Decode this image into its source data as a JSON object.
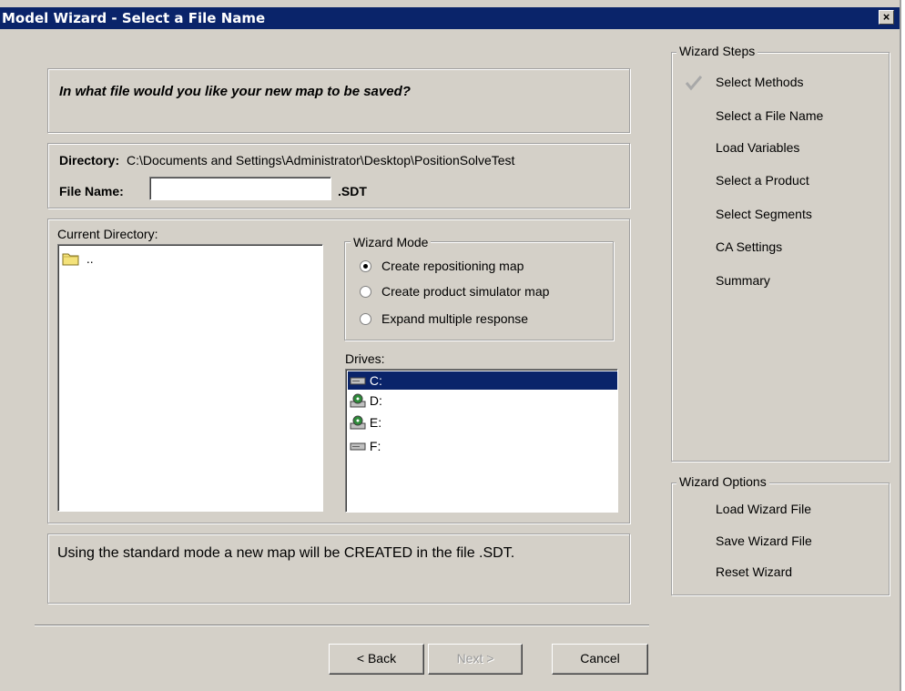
{
  "window": {
    "title": "Model Wizard - Select a File Name",
    "close_glyph": "×"
  },
  "prompt": {
    "text": "In what file would you like your new map to be saved?"
  },
  "directory": {
    "label": "Directory:",
    "path": "C:\\Documents and Settings\\Administrator\\Desktop\\PositionSolveTest"
  },
  "file_name": {
    "label": "File Name:",
    "value": "",
    "extension": ".SDT"
  },
  "current_directory": {
    "label": "Current Directory:",
    "items": [
      ".."
    ]
  },
  "wizard_mode": {
    "legend": "Wizard Mode",
    "options": [
      {
        "label": "Create repositioning map",
        "checked": true
      },
      {
        "label": "Create product simulator map",
        "checked": false
      },
      {
        "label": "Expand multiple response",
        "checked": false
      }
    ]
  },
  "drives": {
    "label": "Drives:",
    "items": [
      {
        "label": "C:",
        "icon": "hard-drive-icon",
        "selected": true
      },
      {
        "label": "D:",
        "icon": "cd-drive-icon",
        "selected": false
      },
      {
        "label": "E:",
        "icon": "cd-drive-icon",
        "selected": false
      },
      {
        "label": "F:",
        "icon": "hard-drive-icon",
        "selected": false
      }
    ]
  },
  "info": {
    "text": "Using the standard mode  a new map will be CREATED in the file .SDT."
  },
  "buttons": {
    "back": "< Back",
    "next": "Next >",
    "cancel": "Cancel"
  },
  "wizard_steps": {
    "legend": "Wizard Steps",
    "items": [
      {
        "label": "Select Methods",
        "done": true
      },
      {
        "label": "Select a File Name",
        "done": false
      },
      {
        "label": "Load Variables",
        "done": false
      },
      {
        "label": "Select a Product",
        "done": false
      },
      {
        "label": "Select Segments",
        "done": false
      },
      {
        "label": "CA Settings",
        "done": false
      },
      {
        "label": "Summary",
        "done": false
      }
    ]
  },
  "wizard_options": {
    "legend": "Wizard Options",
    "items": [
      "Load Wizard File",
      "Save Wizard File",
      "Reset Wizard"
    ]
  },
  "colors": {
    "title_bar": "#0a246a",
    "dialog_face": "#d4d0c8",
    "selection": "#0a246a"
  }
}
